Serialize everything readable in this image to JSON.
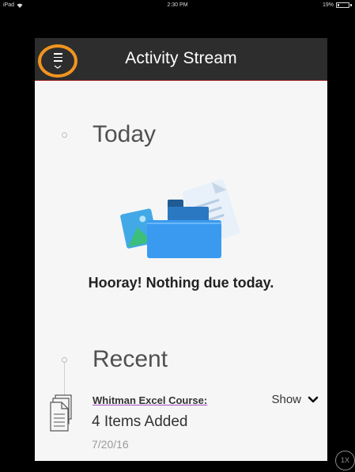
{
  "status_bar": {
    "device": "iPad",
    "time": "2:30 PM",
    "battery": "19%",
    "battery_level": 0.19
  },
  "header": {
    "title": "Activity Stream",
    "menu_icon": "hamburger-menu-icon"
  },
  "sections": {
    "today": {
      "title": "Today",
      "empty_message": "Hooray! Nothing due today.",
      "illustration": "folder-documents-illustration"
    },
    "recent": {
      "title": "Recent",
      "items": [
        {
          "course": "Whitman Excel Course:",
          "summary": "4 Items Added",
          "date": "7/20/16",
          "toggle_label": "Show",
          "icon": "document-stack-icon"
        }
      ]
    }
  },
  "zoom_badge": "1X",
  "colors": {
    "header_bg": "#2d2d2d",
    "menu_highlight": "#f0941f",
    "page_bg": "#f6f6f6",
    "link_underline": "#a04fc0"
  }
}
